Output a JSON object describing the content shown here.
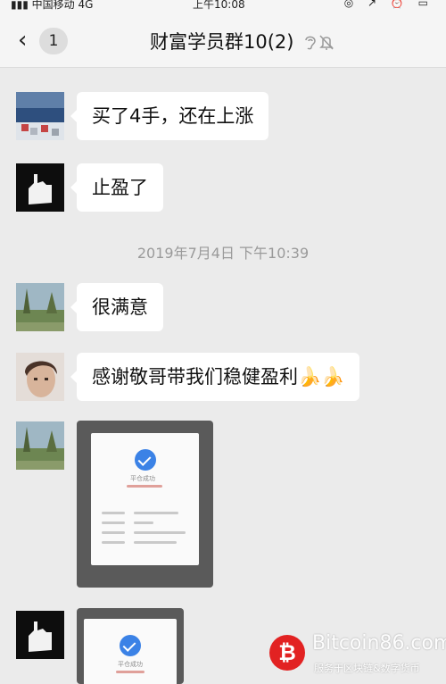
{
  "status_bar": {
    "carrier": "中国移动",
    "network": "4G",
    "time": "上午10:08",
    "indicators": "◎ ↗ ⏰ ▭"
  },
  "header": {
    "back_icon": "chevron-left-icon",
    "unread_count": "1",
    "title": "财富学员群10(2)",
    "icons": [
      "ear-icon",
      "mute-bell-icon"
    ]
  },
  "messages": [
    {
      "type": "text",
      "text": "买了4手，还在上涨",
      "avatar": "blue-blurred-avatar"
    },
    {
      "type": "text",
      "text": "止盈了",
      "avatar": "dark-hand-avatar"
    },
    {
      "type": "timestamp",
      "text": "2019年7月4日 下午10:39"
    },
    {
      "type": "text",
      "text": "很满意",
      "avatar": "landscape-avatar"
    },
    {
      "type": "text",
      "text": "感谢敬哥带我们稳健盈利",
      "emoji": "🍌🍌",
      "avatar": "person-avatar"
    },
    {
      "type": "image",
      "avatar": "landscape-avatar",
      "caption": "平仓成功"
    },
    {
      "type": "image",
      "avatar": "dark-hand-avatar",
      "caption": "平仓成功"
    }
  ],
  "watermark": {
    "logo": "₿",
    "brand": "Bitcoin86.com",
    "tagline": "服务于区块链&数字货币"
  },
  "colors": {
    "background": "#ebebeb",
    "bubble": "#ffffff",
    "accent": "#3b82e6",
    "watermark_logo": "#e22222"
  }
}
